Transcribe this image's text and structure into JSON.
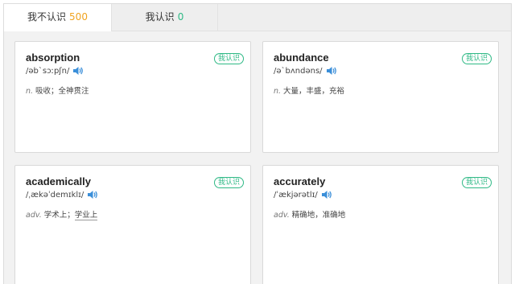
{
  "tabs": [
    {
      "label": "我不认识",
      "count": "500"
    },
    {
      "label": "我认识",
      "count": "0"
    }
  ],
  "know_label": "我认识",
  "cards": [
    {
      "word": "absorption",
      "phonetic": "/əb`sɔːpʃn/",
      "pos": "n.",
      "meaning": "吸收；全神贯注"
    },
    {
      "word": "abundance",
      "phonetic": "/ə`bʌndəns/",
      "pos": "n.",
      "meaning": "大量，丰盛，充裕"
    },
    {
      "word": "academically",
      "phonetic": "/ˌækəˈdemɪklɪ/",
      "pos": "adv.",
      "meaning_a": "学术上；",
      "meaning_b": "学业上"
    },
    {
      "word": "accurately",
      "phonetic": "/ˈækjərətlɪ/",
      "pos": "adv.",
      "meaning": "精确地，准确地"
    }
  ],
  "icons": {
    "speaker": "speaker-icon"
  },
  "colors": {
    "accent_green": "#2eb985",
    "accent_orange": "#f0a31f",
    "speaker_blue": "#3b8fd9"
  }
}
